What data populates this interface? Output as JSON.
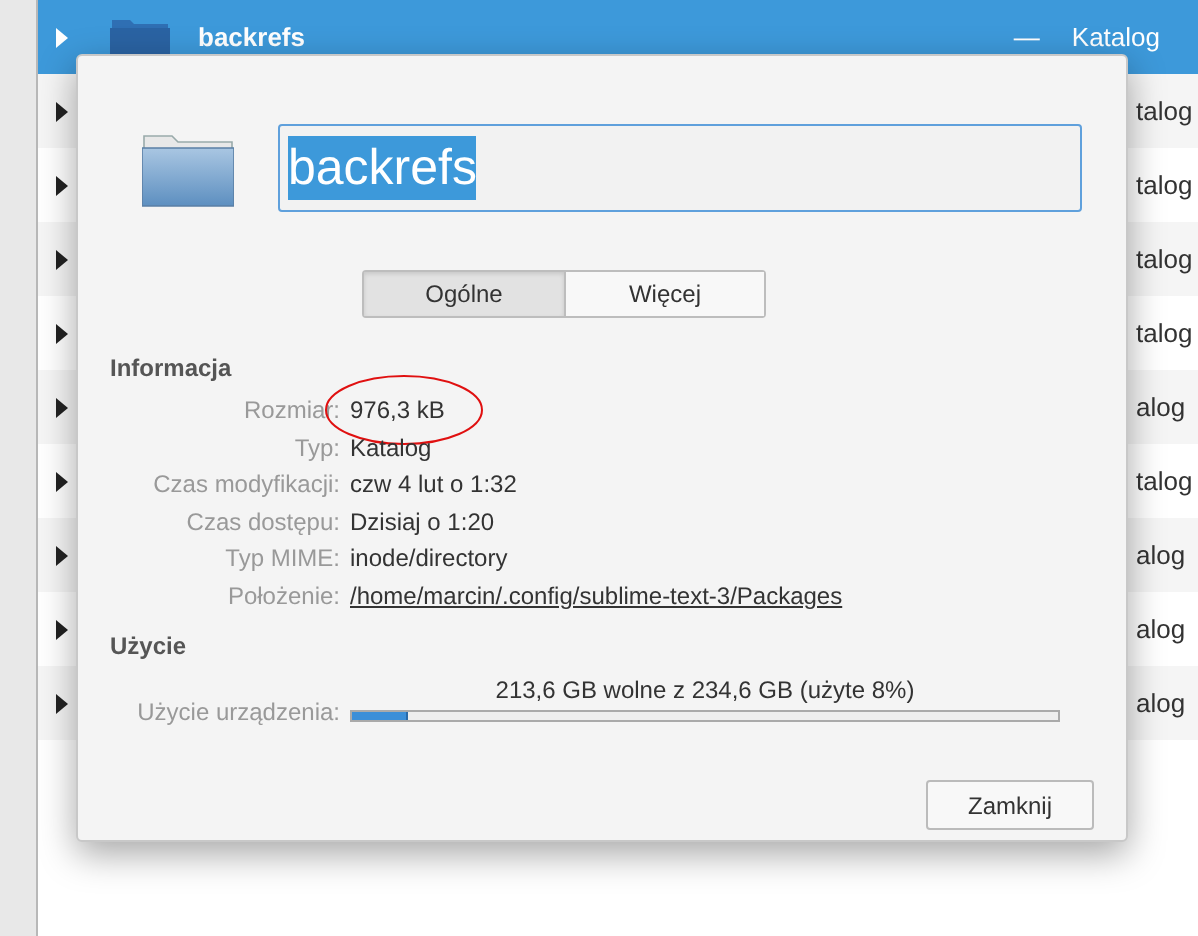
{
  "file_list": {
    "rows": [
      {
        "name": "backrefs",
        "size": "—",
        "type": "Katalog",
        "selected": true
      },
      {
        "type": "talog",
        "selected": false
      },
      {
        "type": "talog",
        "selected": false
      },
      {
        "type": "talog",
        "selected": false
      },
      {
        "type": "talog",
        "selected": false
      },
      {
        "type": "alog",
        "selected": false
      },
      {
        "type": "talog",
        "selected": false
      },
      {
        "type": "alog",
        "selected": false
      },
      {
        "type": "alog",
        "selected": false
      },
      {
        "type": "alog",
        "selected": false
      }
    ]
  },
  "dialog": {
    "name_field": {
      "value": "backrefs",
      "text_selected": true
    },
    "tabs": [
      {
        "label": "Ogólne",
        "selected": true
      },
      {
        "label": "Więcej",
        "selected": false
      }
    ],
    "info": {
      "heading": "Informacja",
      "rows": [
        {
          "label": "Rozmiar:",
          "value": "976,3 kB",
          "circled": true
        },
        {
          "label": "Typ:",
          "value": "Katalog",
          "circled": false
        },
        {
          "label": "Czas modyfikacji:",
          "value": "czw 4 lut o 1:32",
          "circled": false
        },
        {
          "label": "Czas dostępu:",
          "value": "Dzisiaj o 1:20",
          "circled": false
        },
        {
          "label": "Typ MIME:",
          "value": "inode/directory",
          "circled": false
        },
        {
          "label": "Położenie:",
          "value": "/home/marcin/.config/sublime-text-3/Packages",
          "kind": "link",
          "circled": false
        }
      ]
    },
    "usage": {
      "heading": "Użycie",
      "label": "Użycie urządzenia:",
      "reading": "213,6 GB wolne z 234,6 GB (użyte 8%)",
      "level": 0.08
    },
    "buttons": [
      "Zamknij"
    ]
  }
}
